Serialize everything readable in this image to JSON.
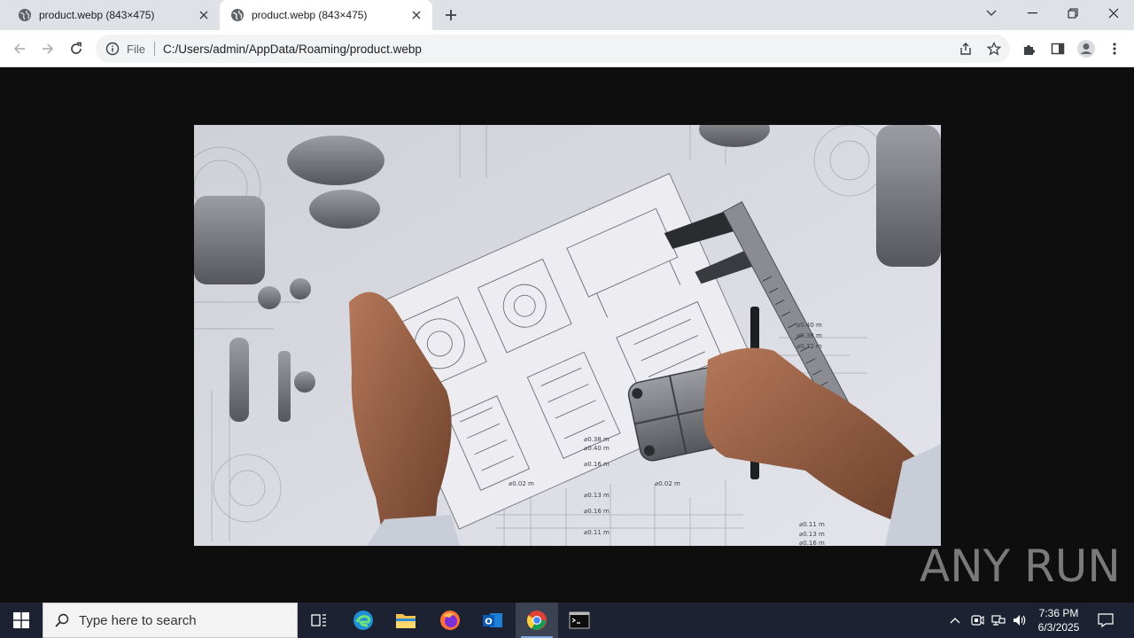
{
  "browser": {
    "tabs": [
      {
        "title": "product.webp (843×475)",
        "active": false
      },
      {
        "title": "product.webp (843×475)",
        "active": true
      }
    ],
    "address": {
      "scheme_label": "File",
      "url": "C:/Users/admin/AppData/Roaming/product.webp"
    }
  },
  "image": {
    "description_icon": "engineering-drawings-photo"
  },
  "watermark": {
    "text": "ANY RUN"
  },
  "taskbar": {
    "search_placeholder": "Type here to search",
    "time": "7:36 PM",
    "date": "6/3/2025"
  },
  "colors": {
    "tabstrip": "#dee1e6",
    "toolbar": "#ffffff",
    "omnibox": "#f1f3f4",
    "viewport": "#0e0e0e",
    "taskbar": "#1c2231"
  }
}
